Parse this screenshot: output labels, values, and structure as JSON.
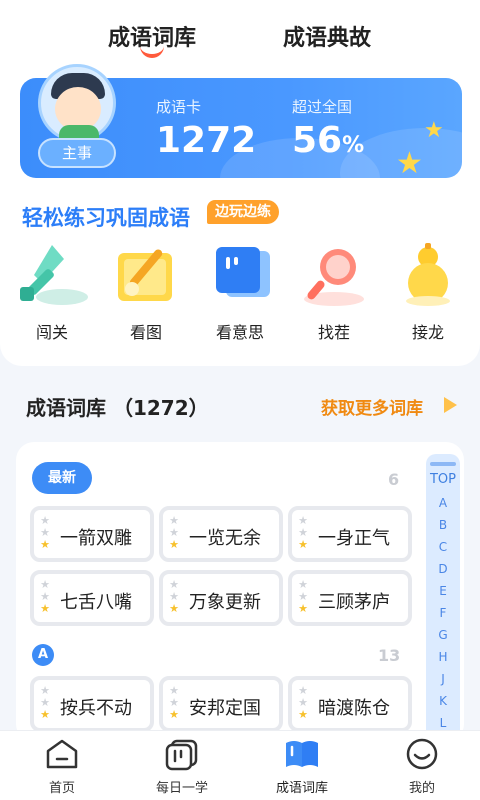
{
  "top_tabs": [
    {
      "label": "成语词库",
      "active": true
    },
    {
      "label": "成语典故",
      "active": false
    }
  ],
  "stat_card": {
    "role_badge": "主事",
    "card_label": "成语卡",
    "card_value": "1272",
    "rank_label": "超过全国",
    "rank_value": "56",
    "rank_unit": "%"
  },
  "practice": {
    "title": "轻松练习巩固成语",
    "tag": "边玩边练",
    "games": [
      {
        "label": "闯关",
        "icon": "sword-icon"
      },
      {
        "label": "看图",
        "icon": "picture-icon"
      },
      {
        "label": "看意思",
        "icon": "card-stack-icon"
      },
      {
        "label": "找茬",
        "icon": "magnifier-icon"
      },
      {
        "label": "接龙",
        "icon": "gourd-icon"
      }
    ]
  },
  "library": {
    "title": "成语词库 （1272）",
    "more_label": "获取更多词库",
    "groups": [
      {
        "chip": "最新",
        "count": "6",
        "idioms": [
          "一箭双雕",
          "一览无余",
          "一身正气",
          "七舌八嘴",
          "万象更新",
          "三顾茅庐"
        ]
      },
      {
        "chip": "A",
        "count": "13",
        "idioms": [
          "按兵不动",
          "安邦定国",
          "暗渡陈仓"
        ]
      }
    ],
    "index": {
      "top": "TOP",
      "letters": [
        "A",
        "B",
        "C",
        "D",
        "E",
        "F",
        "G",
        "H",
        "J",
        "K",
        "L"
      ]
    }
  },
  "bottom_nav": [
    {
      "label": "首页",
      "icon": "home-icon",
      "active": false
    },
    {
      "label": "每日一学",
      "icon": "daily-icon",
      "active": false
    },
    {
      "label": "成语词库",
      "icon": "book-icon",
      "active": true
    },
    {
      "label": "我的",
      "icon": "smile-icon",
      "active": false
    }
  ],
  "colors": {
    "accent_blue": "#3d8cf6",
    "tab_indicator": "#ff5a3c",
    "more_orange": "#f08a12",
    "tag_orange": "#ffa12b"
  }
}
